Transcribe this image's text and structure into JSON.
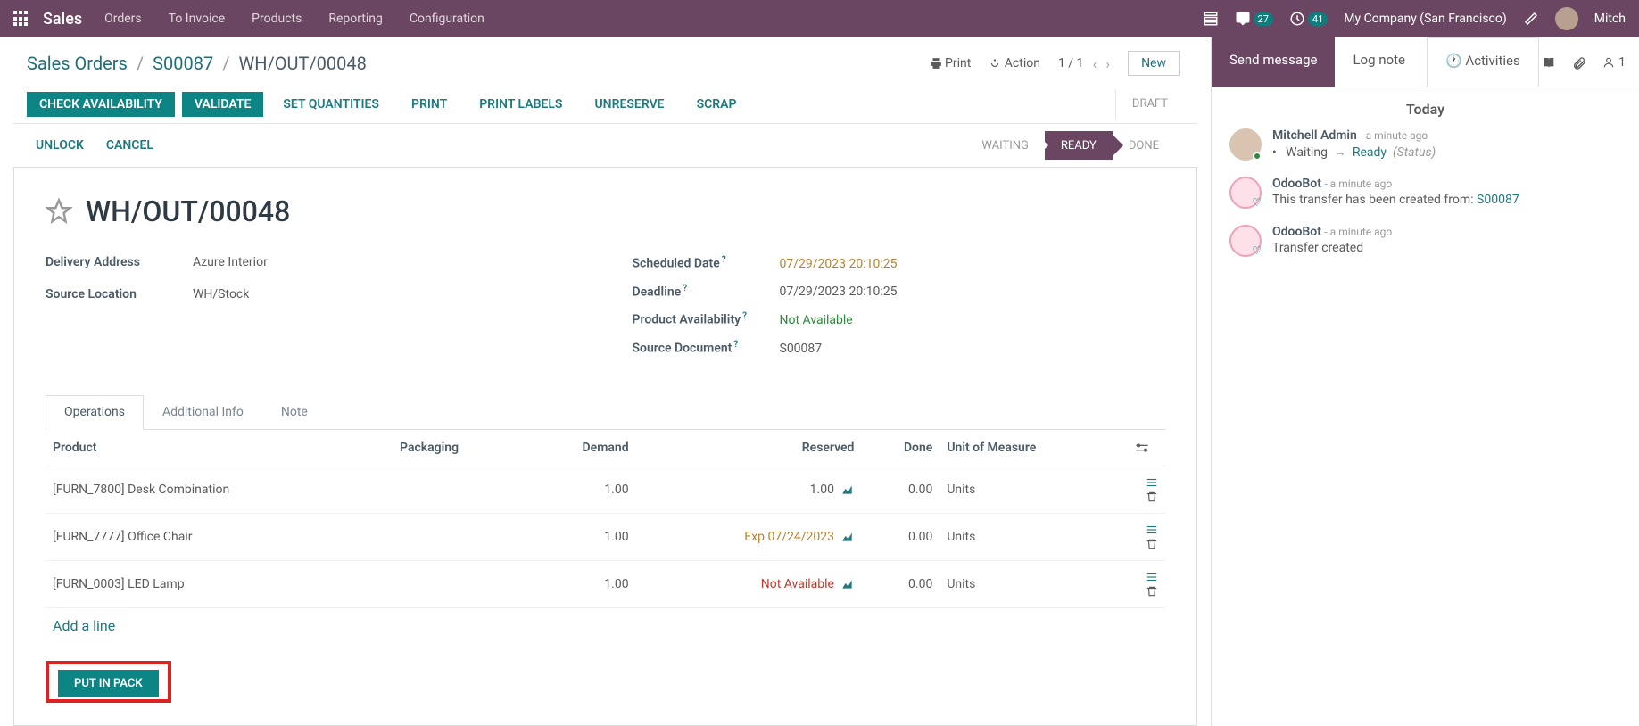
{
  "header": {
    "app_title": "Sales",
    "nav": [
      "Orders",
      "To Invoice",
      "Products",
      "Reporting",
      "Configuration"
    ],
    "chat_badge": "27",
    "clock_badge": "41",
    "company": "My Company (San Francisco)",
    "user_short": "Mitch"
  },
  "breadcrumb": {
    "root": "Sales Orders",
    "parent": "S00087",
    "current": "WH/OUT/00048"
  },
  "toolbar": {
    "print": "Print",
    "action": "Action",
    "pager": "1 / 1",
    "new": "New"
  },
  "buttons": {
    "check_availability": "CHECK AVAILABILITY",
    "validate": "VALIDATE",
    "set_quantities": "SET QUANTITIES",
    "print": "PRINT",
    "print_labels": "PRINT LABELS",
    "unreserve": "UNRESERVE",
    "scrap": "SCRAP",
    "unlock": "UNLOCK",
    "cancel": "CANCEL",
    "put_in_pack": "PUT IN PACK"
  },
  "status_steps": {
    "draft": "DRAFT",
    "waiting": "WAITING",
    "ready": "READY",
    "done": "DONE"
  },
  "record": {
    "title": "WH/OUT/00048",
    "delivery_address_label": "Delivery Address",
    "delivery_address": "Azure Interior",
    "source_location_label": "Source Location",
    "source_location": "WH/Stock",
    "scheduled_date_label": "Scheduled Date",
    "scheduled_date": "07/29/2023 20:10:25",
    "deadline_label": "Deadline",
    "deadline": "07/29/2023 20:10:25",
    "availability_label": "Product Availability",
    "availability": "Not Available",
    "source_doc_label": "Source Document",
    "source_doc": "S00087"
  },
  "tabs": {
    "operations": "Operations",
    "additional": "Additional Info",
    "note": "Note"
  },
  "table": {
    "headers": {
      "product": "Product",
      "packaging": "Packaging",
      "demand": "Demand",
      "reserved": "Reserved",
      "done": "Done",
      "uom": "Unit of Measure"
    },
    "rows": [
      {
        "product": "[FURN_7800] Desk Combination",
        "packaging": "",
        "demand": "1.00",
        "reserved": "1.00",
        "reserved_class": "",
        "done": "0.00",
        "uom": "Units"
      },
      {
        "product": "[FURN_7777] Office Chair",
        "packaging": "",
        "demand": "1.00",
        "reserved": "Exp 07/24/2023",
        "reserved_class": "warn",
        "done": "0.00",
        "uom": "Units"
      },
      {
        "product": "[FURN_0003] LED Lamp",
        "packaging": "",
        "demand": "1.00",
        "reserved": "Not Available",
        "reserved_class": "err",
        "done": "0.00",
        "uom": "Units"
      }
    ],
    "add_line": "Add a line"
  },
  "chatter": {
    "send_message": "Send message",
    "log_note": "Log note",
    "activities": "Activities",
    "follower_count": "1",
    "today": "Today",
    "messages": [
      {
        "author": "Mitchell Admin",
        "time": "a minute ago",
        "type": "status",
        "bullet": "•",
        "from": "Waiting",
        "to": "Ready",
        "status_label": "(Status)",
        "avatar": "user"
      },
      {
        "author": "OdooBot",
        "time": "a minute ago",
        "type": "text",
        "body_prefix": "This transfer has been created from: ",
        "body_link": "S00087",
        "avatar": "bot"
      },
      {
        "author": "OdooBot",
        "time": "a minute ago",
        "type": "text",
        "body_prefix": "Transfer created",
        "body_link": "",
        "avatar": "bot"
      }
    ]
  }
}
